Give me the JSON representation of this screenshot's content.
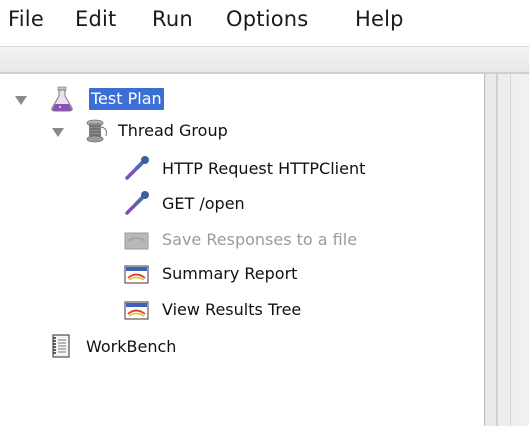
{
  "menu": {
    "items": [
      "File",
      "Edit",
      "Run",
      "Options",
      "Help"
    ]
  },
  "tree": {
    "test_plan": "Test Plan",
    "thread_group": "Thread Group",
    "http_request": "HTTP Request HTTPClient",
    "get_open": "GET /open",
    "save_responses": "Save Responses to a file",
    "summary_report": "Summary Report",
    "view_results_tree": "View Results Tree",
    "workbench": "WorkBench"
  },
  "colors": {
    "selection": "#3b6fd6",
    "disabled_text": "#9b9b9b"
  },
  "icons": {
    "test_plan": "flask-icon",
    "thread_group": "spool-icon",
    "sampler": "pipette-icon",
    "disabled_listener": "disabled-listener-icon",
    "listener": "graph-listener-icon",
    "workbench": "notebook-icon"
  }
}
